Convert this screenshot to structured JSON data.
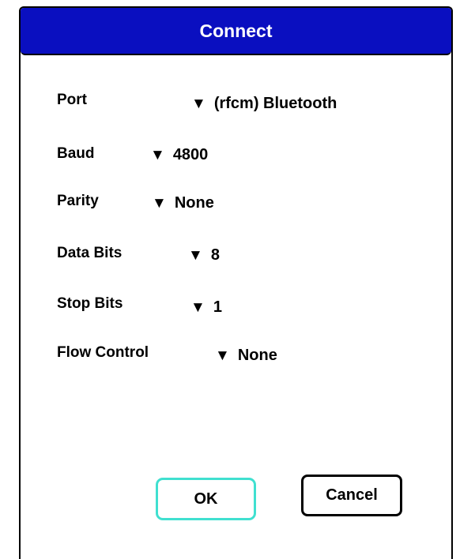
{
  "dialog": {
    "title": "Connect",
    "title_bar_color": "#0a0fc0"
  },
  "fields": {
    "port": {
      "label": "Port",
      "value": "(rfcm)  Bluetooth"
    },
    "baud": {
      "label": "Baud",
      "value": "4800"
    },
    "parity": {
      "label": "Parity",
      "value": "None"
    },
    "data_bits": {
      "label": "Data Bits",
      "value": "8"
    },
    "stop_bits": {
      "label": "Stop Bits",
      "value": "1"
    },
    "flow_control": {
      "label": "Flow Control",
      "value": "None"
    }
  },
  "dropdown_icon": "down-triangle-icon",
  "buttons": {
    "ok": "OK",
    "cancel": "Cancel",
    "ok_focus_color": "#40e0d0"
  }
}
